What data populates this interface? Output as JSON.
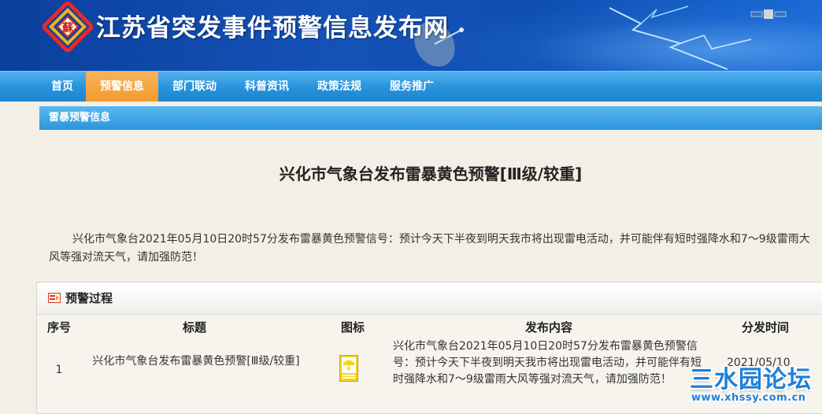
{
  "site": {
    "title": "江苏省突发事件预警信息发布网",
    "logo_char": "蘇"
  },
  "nav": {
    "items": [
      {
        "label": "首页"
      },
      {
        "label": "预警信息",
        "active": true
      },
      {
        "label": "部门联动"
      },
      {
        "label": "科普资讯"
      },
      {
        "label": "政策法规"
      },
      {
        "label": "服务推广"
      }
    ]
  },
  "section": {
    "label": "雷暴预警信息"
  },
  "article": {
    "title": "兴化市气象台发布雷暴黄色预警[Ⅲ级/较重]",
    "body": "兴化市气象台2021年05月10日20时57分发布雷暴黄色预警信号：预计今天下半夜到明天我市将出现雷电活动，并可能伴有短时强降水和7～9级雷雨大风等强对流天气，请加强防范！"
  },
  "process": {
    "title": "预警过程",
    "columns": [
      "序号",
      "标题",
      "图标",
      "发布内容",
      "分发时间"
    ],
    "rows": [
      {
        "index": "1",
        "title": "兴化市气象台发布雷暴黄色预警[Ⅲ级/较重]",
        "icon": "thunderstorm-yellow-warning-icon",
        "content": "兴化市气象台2021年05月10日20时57分发布雷暴黄色预警信号：预计今天下半夜到明天我市将出现雷电活动，并可能伴有短时强降水和7～9级雷雨大风等强对流天气，请加强防范！",
        "time": "2021/05/10"
      }
    ]
  },
  "watermark": {
    "main": "三水园论坛",
    "url": "www.xhssy.com.cn"
  },
  "colors": {
    "banner": "#1552b8",
    "nav": "#2592db",
    "nav_active": "#f39a2c",
    "accent_blue": "#1e7fd8",
    "warning_yellow": "#f5d41c"
  }
}
